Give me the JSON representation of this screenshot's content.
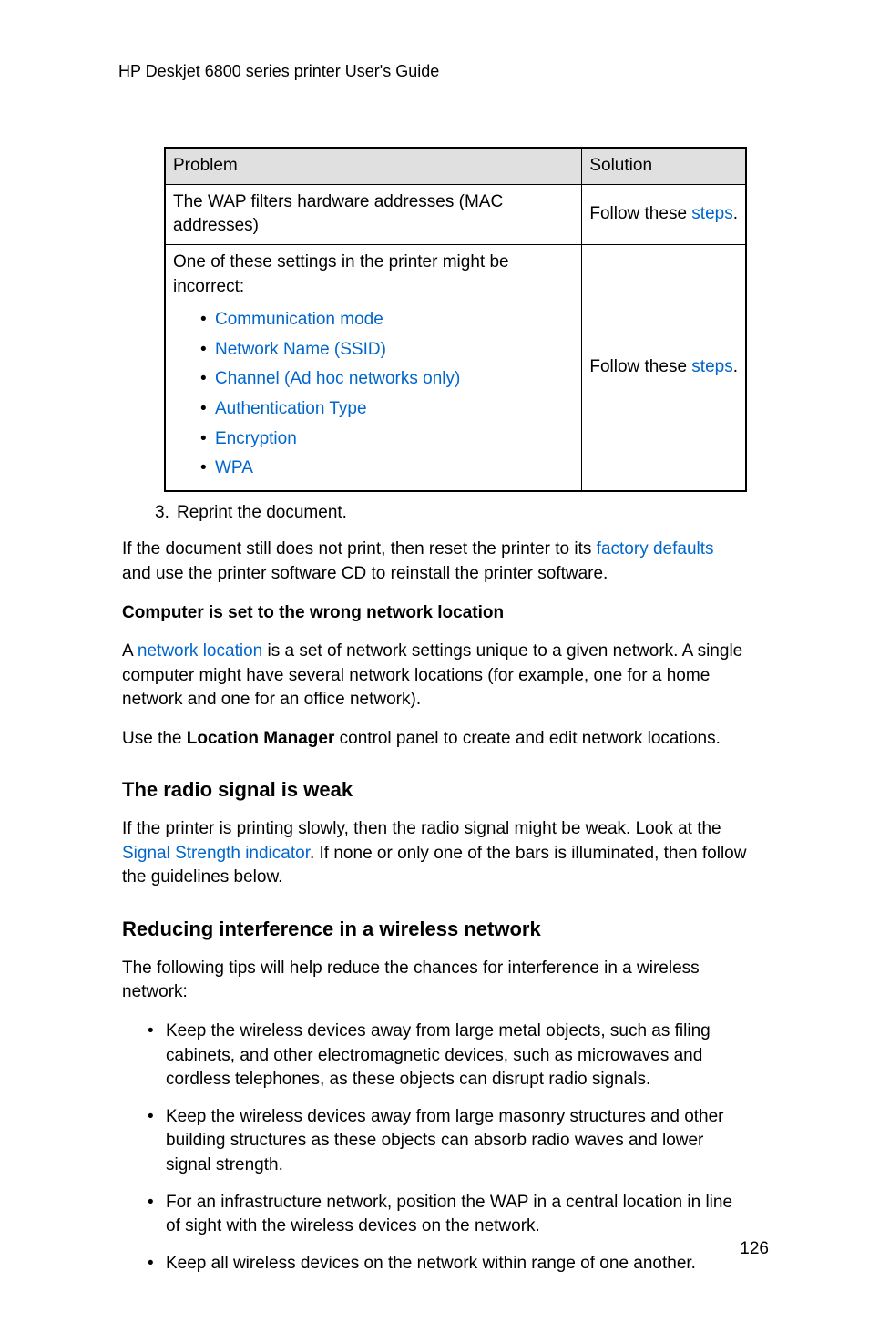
{
  "header": "HP Deskjet 6800 series printer User's Guide",
  "table": {
    "headers": {
      "problem": "Problem",
      "solution": "Solution"
    },
    "row1": {
      "problem": "The WAP filters hardware addresses (MAC addresses)",
      "solution_pre": "Follow these ",
      "solution_link": "steps",
      "solution_post": "."
    },
    "row2": {
      "intro": "One of these settings in the printer might be incorrect:",
      "items": [
        "Communication mode",
        "Network Name (SSID)",
        "Channel (Ad hoc networks only)",
        "Authentication Type",
        "Encryption",
        "WPA"
      ],
      "solution_pre": "Follow these ",
      "solution_link": "steps",
      "solution_post": "."
    }
  },
  "step3": {
    "marker": "3.",
    "text": "Reprint the document."
  },
  "para1": {
    "pre": "If the document still does not print, then reset the printer to its ",
    "link": "factory defaults",
    "post": " and use the printer software CD to reinstall the printer software."
  },
  "h_wrong_loc": "Computer is set to the wrong network location",
  "para2": {
    "pre": "A ",
    "link": "network location",
    "post": " is a set of network settings unique to a given network. A single computer might have several network locations (for example, one for a home network and one for an office network)."
  },
  "para3": {
    "pre": "Use the ",
    "bold": "Location Manager",
    "post": " control panel to create and edit network locations."
  },
  "h_radio": "The radio signal is weak",
  "para4": {
    "pre": "If the printer is printing slowly, then the radio signal might be weak. Look at the ",
    "link": "Signal Strength indicator",
    "post": ". If none or only one of the bars is illuminated, then follow the guidelines below."
  },
  "h_reduce": "Reducing interference in a wireless network",
  "para5": "The following tips will help reduce the chances for interference in a wireless network:",
  "tips": [
    "Keep the wireless devices away from large metal objects, such as filing cabinets, and other electromagnetic devices, such as microwaves and cordless telephones, as these objects can disrupt radio signals.",
    "Keep the wireless devices away from large masonry structures and other building structures as these objects can absorb radio waves and lower signal strength.",
    "For an infrastructure network, position the WAP in a central location in line of sight with the wireless devices on the network.",
    "Keep all wireless devices on the network within range of one another."
  ],
  "page_number": "126"
}
